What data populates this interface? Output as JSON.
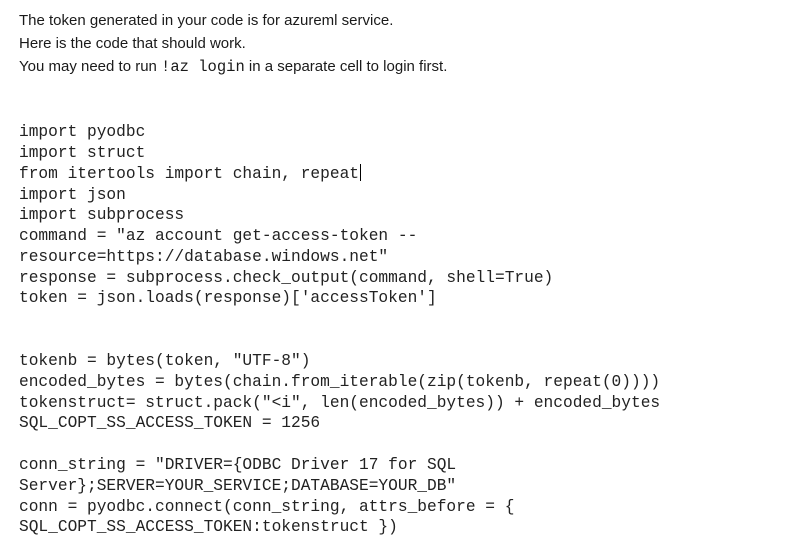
{
  "prose": {
    "line1": "The token generated in your code is for azureml service.",
    "line2": "Here is the code that should work.",
    "line3_before": "You may need to run ",
    "line3_code": "!az login",
    "line3_after": " in a separate cell to login first."
  },
  "code_block_1": [
    "import pyodbc",
    "import struct",
    "from itertools import chain, repeat",
    "import json",
    "import subprocess",
    "command = \"az account get-access-token --",
    "resource=https://database.windows.net\"",
    "response = subprocess.check_output(command, shell=True)",
    "token = json.loads(response)['accessToken']"
  ],
  "code_block_2": [
    "tokenb = bytes(token, \"UTF-8\")",
    "encoded_bytes = bytes(chain.from_iterable(zip(tokenb, repeat(0))))",
    "tokenstruct= struct.pack(\"<i\", len(encoded_bytes)) + encoded_bytes",
    "SQL_COPT_SS_ACCESS_TOKEN = 1256"
  ],
  "code_block_3": [
    "conn_string = \"DRIVER={ODBC Driver 17 for SQL",
    "Server};SERVER=YOUR_SERVICE;DATABASE=YOUR_DB\"",
    "conn = pyodbc.connect(conn_string, attrs_before = {",
    "SQL_COPT_SS_ACCESS_TOKEN:tokenstruct })"
  ]
}
